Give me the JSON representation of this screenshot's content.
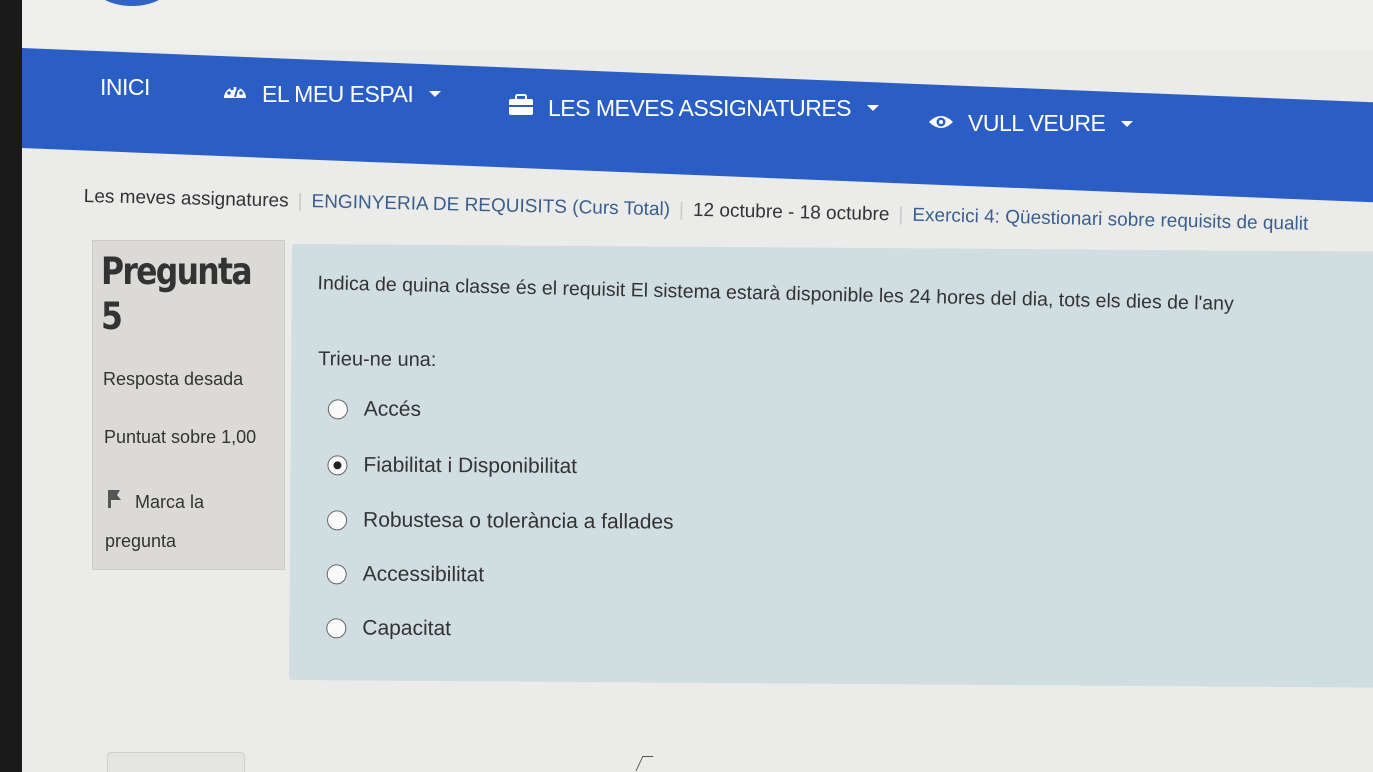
{
  "nav": {
    "home_label": "INICI",
    "my_space_label": "EL MEU ESPAI",
    "my_subjects_label": "LES MEVES ASSIGNATURES",
    "view_label": "VULL VEURE"
  },
  "breadcrumb": {
    "items": [
      "Les meves assignatures",
      "ENGINYERIA DE REQUISITS (Curs Total)",
      "12 octubre - 18 octubre",
      "Exercici 4: Qüestionari sobre requisits de qualit"
    ]
  },
  "question_info": {
    "title": "Pregunta",
    "number": "5",
    "state": "Resposta desada",
    "grade": "Puntuat sobre 1,00",
    "flag_label_line1": "Marca la",
    "flag_label_line2": "pregunta"
  },
  "question": {
    "text": "Indica de quina classe és el requisit El sistema estarà disponible les 24 hores del dia, tots els dies de l'any",
    "prompt": "Trieu-ne una:",
    "options": [
      {
        "label": "Accés",
        "selected": false
      },
      {
        "label": "Fiabilitat i Disponibilitat",
        "selected": true
      },
      {
        "label": "Robustesa o tolerància a fallades",
        "selected": false
      },
      {
        "label": "Accessibilitat",
        "selected": false
      },
      {
        "label": "Capacitat",
        "selected": false
      }
    ]
  },
  "colors": {
    "nav_background": "#2a5ec4",
    "content_background": "#d0dde1",
    "info_background": "#dcdad6",
    "link": "#3a5f8e"
  },
  "icons": {
    "my_space": "dashboard-gauge-icon",
    "my_subjects": "briefcase-icon",
    "view": "eye-icon",
    "flag": "flag-icon"
  }
}
